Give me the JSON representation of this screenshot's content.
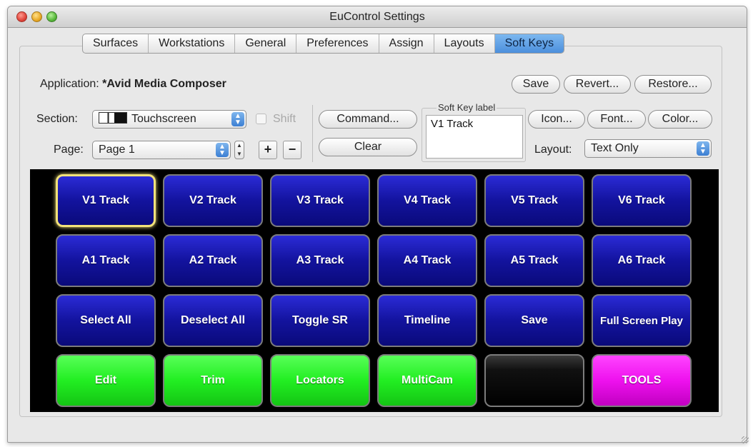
{
  "window": {
    "title": "EuControl Settings"
  },
  "tabs": [
    {
      "label": "Surfaces"
    },
    {
      "label": "Workstations"
    },
    {
      "label": "General"
    },
    {
      "label": "Preferences"
    },
    {
      "label": "Assign"
    },
    {
      "label": "Layouts"
    },
    {
      "label": "Soft Keys",
      "active": true
    }
  ],
  "application": {
    "label": "Application:",
    "value": "*Avid Media Composer"
  },
  "actions": {
    "save": "Save",
    "revert": "Revert...",
    "restore": "Restore..."
  },
  "section": {
    "label": "Section:",
    "value": "Touchscreen"
  },
  "shift": {
    "label": "Shift",
    "checked": false,
    "enabled": false
  },
  "page": {
    "label": "Page:",
    "value": "Page 1"
  },
  "page_buttons": {
    "add": "+",
    "remove": "−"
  },
  "command": {
    "command_label": "Command...",
    "clear_label": "Clear"
  },
  "soft_key_label": {
    "legend": "Soft Key label",
    "value": "V1 Track"
  },
  "appearance": {
    "icon": "Icon...",
    "font": "Font...",
    "color": "Color..."
  },
  "layout": {
    "label": "Layout:",
    "value": "Text Only"
  },
  "colors": {
    "blue": "#13139e",
    "green": "#22ee22",
    "magenta": "#ee11ee",
    "black": "#000000",
    "selected_border": "#f2e27a"
  },
  "keys": [
    [
      {
        "label": "V1 Track",
        "color": "blue",
        "selected": true
      },
      {
        "label": "V2 Track",
        "color": "blue"
      },
      {
        "label": "V3 Track",
        "color": "blue"
      },
      {
        "label": "V4 Track",
        "color": "blue"
      },
      {
        "label": "V5 Track",
        "color": "blue"
      },
      {
        "label": "V6 Track",
        "color": "blue"
      }
    ],
    [
      {
        "label": "A1 Track",
        "color": "blue"
      },
      {
        "label": "A2 Track",
        "color": "blue"
      },
      {
        "label": "A3 Track",
        "color": "blue"
      },
      {
        "label": "A4 Track",
        "color": "blue"
      },
      {
        "label": "A5 Track",
        "color": "blue"
      },
      {
        "label": "A6 Track",
        "color": "blue"
      }
    ],
    [
      {
        "label": "Select All",
        "color": "blue"
      },
      {
        "label": "Deselect All",
        "color": "blue"
      },
      {
        "label": "Toggle SR",
        "color": "blue"
      },
      {
        "label": "Timeline",
        "color": "blue"
      },
      {
        "label": "Save",
        "color": "blue"
      },
      {
        "label": "Full Screen Play",
        "color": "blue"
      }
    ],
    [
      {
        "label": "Edit",
        "color": "green"
      },
      {
        "label": "Trim",
        "color": "green"
      },
      {
        "label": "Locators",
        "color": "green"
      },
      {
        "label": "MultiCam",
        "color": "green"
      },
      {
        "label": "",
        "color": "black"
      },
      {
        "label": "TOOLS",
        "color": "magenta"
      }
    ]
  ]
}
